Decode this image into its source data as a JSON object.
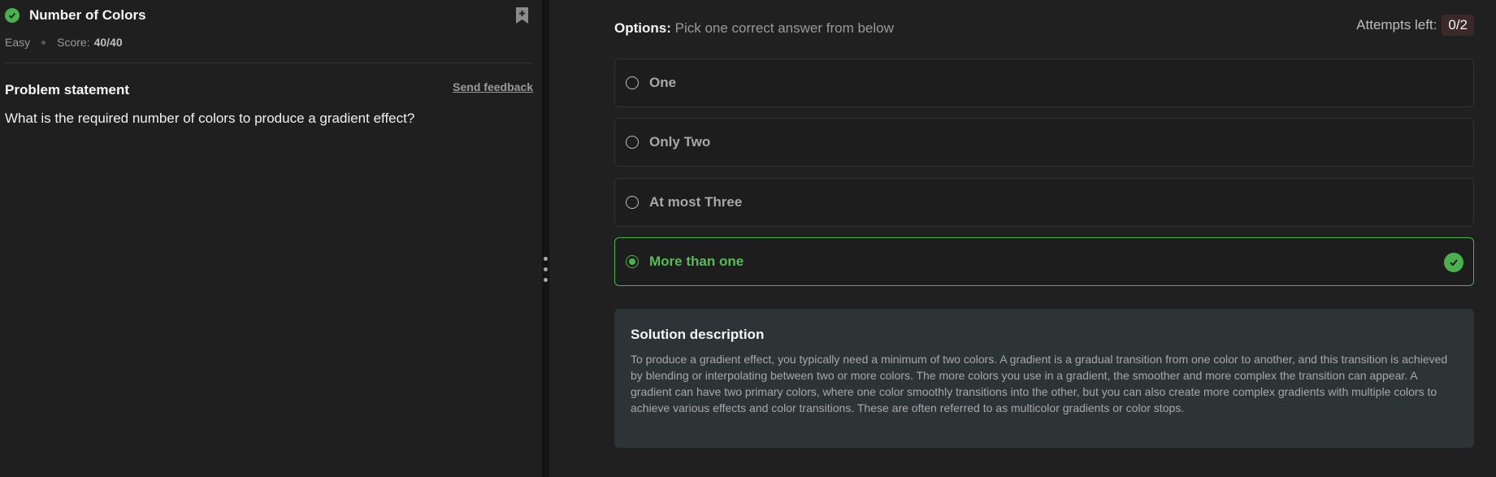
{
  "problem": {
    "title": "Number of Colors",
    "difficulty": "Easy",
    "score_label": "Score:",
    "score_value": "40/40",
    "statement_heading": "Problem statement",
    "feedback_link": "Send feedback",
    "statement": "What is the required number of colors to produce a gradient effect?"
  },
  "quiz": {
    "options_heading": "Options:",
    "options_hint": "Pick one correct answer from below",
    "attempts_label": "Attempts left:",
    "attempts_value": "0/2",
    "options": [
      {
        "label": "One",
        "selected": false
      },
      {
        "label": "Only Two",
        "selected": false
      },
      {
        "label": "At most Three",
        "selected": false
      },
      {
        "label": "More than one",
        "selected": true,
        "correct": true
      }
    ]
  },
  "solution": {
    "heading": "Solution description",
    "text": "To produce a gradient effect, you typically need a minimum of two colors. A gradient is a gradual transition from one color to another, and this transition is achieved by blending or interpolating between two or more colors. The more colors you use in a gradient, the smoother and more complex the transition can appear. A gradient can have two primary colors, where one color smoothly transitions into the other, but you can also create more complex gradients with multiple colors to achieve various effects and color transitions. These are often referred to as multicolor gradients or color stops."
  },
  "colors": {
    "success": "#4caf50",
    "solution_bg": "#2d3436",
    "badge_bg": "#3b2828"
  },
  "icons": [
    "check-circle-icon",
    "bookmark-add-icon",
    "radio-icon",
    "drag-handle-icon"
  ]
}
